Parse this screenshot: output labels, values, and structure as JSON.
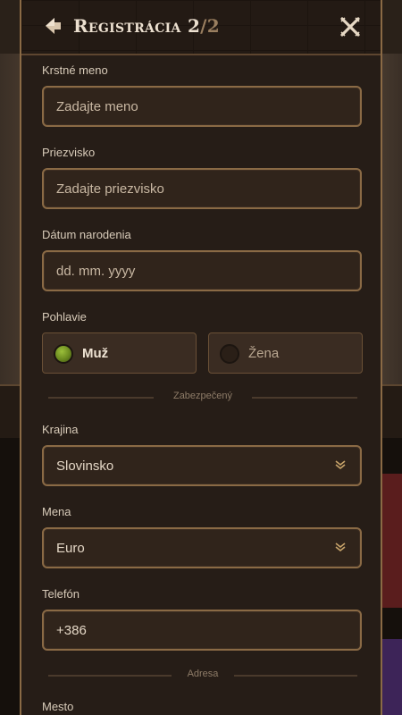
{
  "header": {
    "title": "Registrácia 2",
    "title_total": "/2"
  },
  "form": {
    "first_name": {
      "label": "Krstné meno",
      "placeholder": "Zadajte meno"
    },
    "last_name": {
      "label": "Priezvisko",
      "placeholder": "Zadajte priezvisko"
    },
    "birth_date": {
      "label": "Dátum narodenia",
      "placeholder": "dd. mm. yyyy"
    },
    "gender": {
      "label": "Pohlavie",
      "options": [
        {
          "label": "Muž",
          "selected": true
        },
        {
          "label": "Žena",
          "selected": false
        }
      ]
    },
    "section_security": "Zabezpečený",
    "country": {
      "label": "Krajina",
      "value": "Slovinsko"
    },
    "currency": {
      "label": "Mena",
      "value": "Euro"
    },
    "phone": {
      "label": "Telefón",
      "value": "+386"
    },
    "section_address": "Adresa",
    "city": {
      "label": "Mesto"
    }
  },
  "colors": {
    "accent_border": "#8a6a45",
    "modal_bg": "#261d17",
    "selected_radio": "#6b8a1f"
  },
  "icons": {
    "back": "back-arrow-icon",
    "close": "close-icon",
    "dropdown": "chevron-down-icon"
  }
}
